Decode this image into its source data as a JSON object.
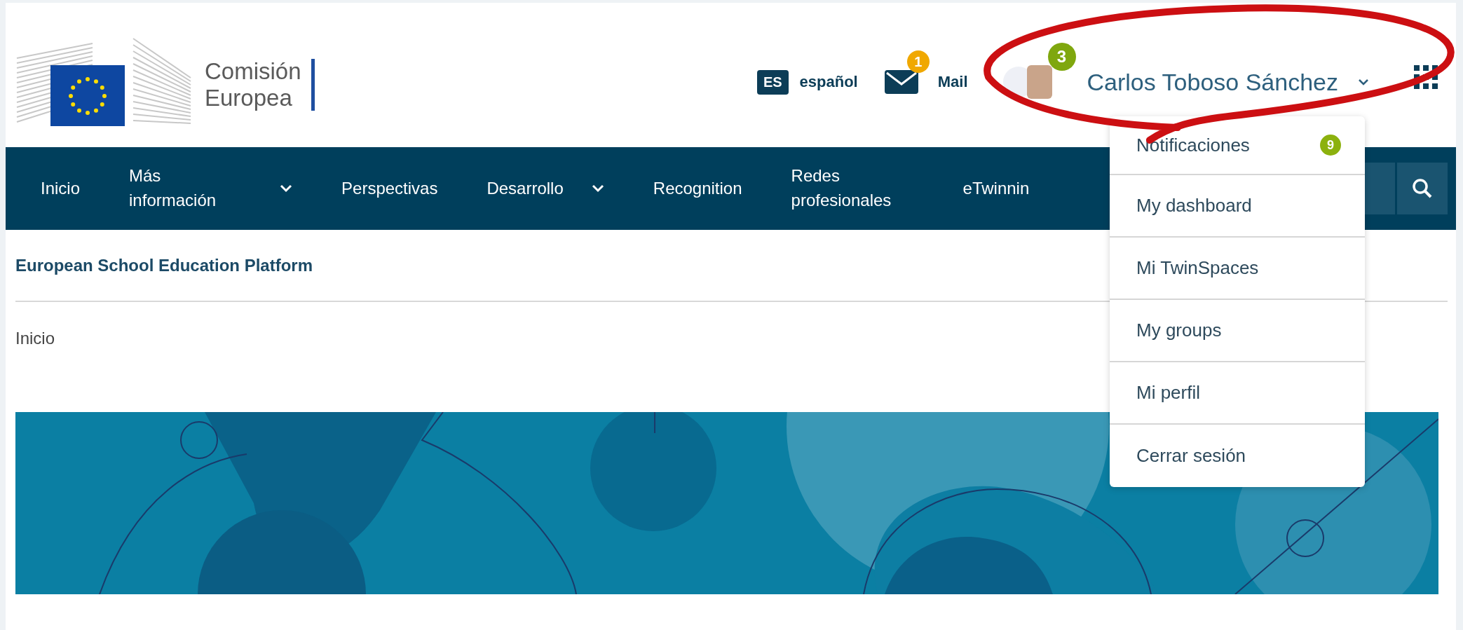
{
  "header": {
    "logo": {
      "line1": "Comisión",
      "line2": "Europea"
    },
    "language": {
      "code": "ES",
      "label": "español"
    },
    "mail": {
      "label": "Mail",
      "badge": "1"
    },
    "user": {
      "badge": "3",
      "name": "Carlos Toboso Sánchez",
      "expanded": true
    }
  },
  "nav": {
    "items": [
      {
        "label": "Inicio",
        "has_submenu": false
      },
      {
        "label": "Más información",
        "has_submenu": true
      },
      {
        "label": "Perspectivas",
        "has_submenu": false
      },
      {
        "label": "Desarrollo",
        "has_submenu": true
      },
      {
        "label": "Recognition",
        "has_submenu": false
      },
      {
        "label": "Redes profesionales",
        "has_submenu": false
      },
      {
        "label": "eTwinnin",
        "has_submenu": false
      }
    ]
  },
  "user_menu": {
    "items": [
      {
        "label": "Notificaciones",
        "badge": "9"
      },
      {
        "label": "My dashboard"
      },
      {
        "label": "Mi TwinSpaces"
      },
      {
        "label": "My groups"
      },
      {
        "label": "Mi perfil"
      },
      {
        "label": "Cerrar sesión"
      }
    ]
  },
  "site_title": "European School Education Platform",
  "breadcrumb": "Inicio"
}
